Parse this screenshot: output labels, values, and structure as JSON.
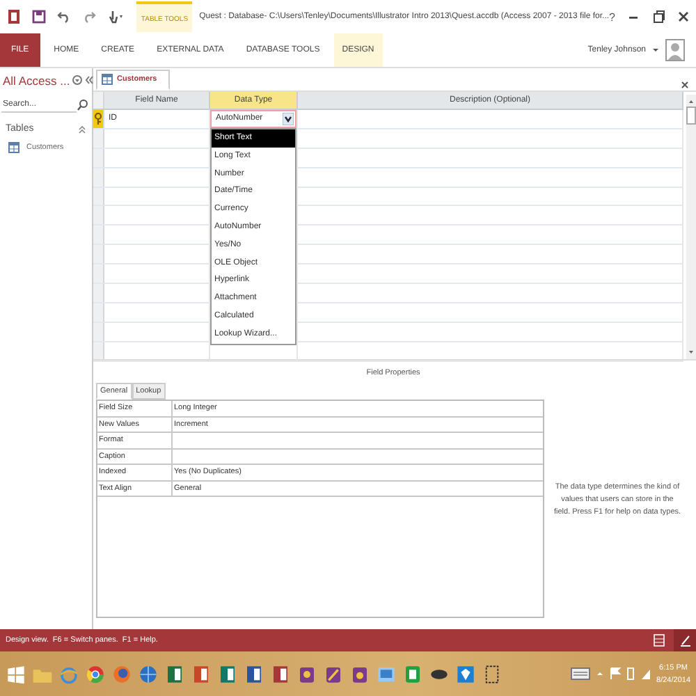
{
  "title_bar": {
    "context_label": "TABLE TOOLS",
    "title": "Quest : Database- C:\\Users\\Tenley\\Documents\\Illustrator Intro 2013\\Quest.accdb (Access 2007 - 2013 file for...",
    "help": "?"
  },
  "ribbon_tabs": [
    {
      "label": "FILE",
      "kind": "file"
    },
    {
      "label": "HOME",
      "kind": "normal"
    },
    {
      "label": "CREATE",
      "kind": "normal"
    },
    {
      "label": "EXTERNAL DATA",
      "kind": "normal"
    },
    {
      "label": "DATABASE TOOLS",
      "kind": "normal"
    },
    {
      "label": "DESIGN",
      "kind": "contextual"
    }
  ],
  "user": {
    "name": "Tenley Johnson"
  },
  "nav_pane": {
    "title": "All Access ...",
    "search": {
      "placeholder": "Search..."
    },
    "groups": [
      {
        "label": "Tables",
        "items": [
          {
            "label": "Customers"
          }
        ]
      }
    ]
  },
  "document_tabs": [
    {
      "label": "Customers",
      "selected": true
    }
  ],
  "design_grid": {
    "columns": [
      {
        "label": "Field Name",
        "selected": false
      },
      {
        "label": "Data Type",
        "selected": true
      },
      {
        "label": "Description (Optional)",
        "selected": false
      }
    ],
    "rows": [
      {
        "field_name": "ID",
        "data_type": "AutoNumber",
        "primary_key": true
      }
    ]
  },
  "data_type_dropdown": {
    "options": [
      {
        "label": "Short Text",
        "selected": true
      },
      {
        "label": "Long Text",
        "selected": false
      },
      {
        "label": "Number",
        "selected": false
      },
      {
        "label": "Date/Time",
        "selected": false
      },
      {
        "label": "Currency",
        "selected": false
      },
      {
        "label": "AutoNumber",
        "selected": false
      },
      {
        "label": "Yes/No",
        "selected": false
      },
      {
        "label": "OLE Object",
        "selected": false
      },
      {
        "label": "Hyperlink",
        "selected": false
      },
      {
        "label": "Attachment",
        "selected": false
      },
      {
        "label": "Calculated",
        "selected": false
      },
      {
        "label": "Lookup Wizard...",
        "selected": false
      }
    ]
  },
  "field_properties": {
    "title": "Field Properties",
    "tabs": [
      {
        "label": "General",
        "selected": true
      },
      {
        "label": "Lookup",
        "selected": false
      }
    ],
    "properties": [
      {
        "name": "Field Size",
        "value": "Long Integer"
      },
      {
        "name": "New Values",
        "value": "Increment"
      },
      {
        "name": "Format"
      },
      {
        "name": "Caption"
      },
      {
        "name": "Indexed",
        "value": "Yes (No Duplicates)"
      },
      {
        "name": "Text Align",
        "value": "General"
      }
    ],
    "help_text": "The data type determines the kind of values that users can store in the field. Press F1 for help on data types."
  },
  "status_bar": {
    "text": "Design view.  F6 = Switch panes.  F1 = Help."
  },
  "taskbar": {
    "time": "6:15 PM",
    "date": "8/24/2014"
  }
}
